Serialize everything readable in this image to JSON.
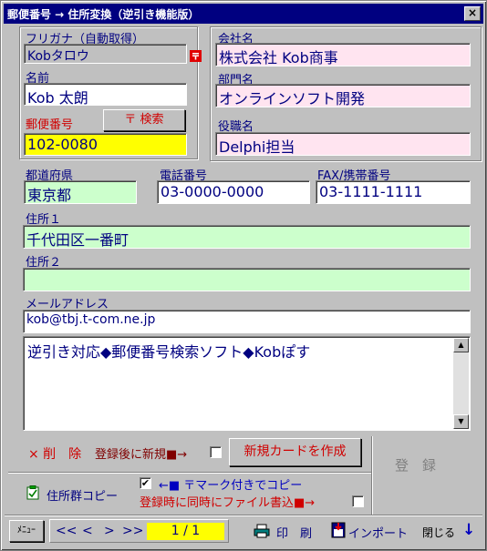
{
  "window": {
    "title": "郵便番号 → 住所変換（逆引き機能版）",
    "close_label": "×"
  },
  "furigana": {
    "label": "フリガナ（自動取得）",
    "value": "Kobタロウ"
  },
  "name": {
    "label": "名前",
    "value": "Kob 太朗"
  },
  "postal": {
    "label": "郵便番号",
    "value": "102-0080",
    "search_button": "〒 検索"
  },
  "company": {
    "label": "会社名",
    "value": "株式会社 Kob商事"
  },
  "department": {
    "label": "部門名",
    "value": "オンラインソフト開発"
  },
  "position": {
    "label": "役職名",
    "value": "Delphi担当"
  },
  "prefecture": {
    "label": "都道府県",
    "value": "東京都"
  },
  "phone": {
    "label": "電話番号",
    "value": "03-0000-0000"
  },
  "fax": {
    "label": "FAX/携帯番号",
    "value": "03-1111-1111"
  },
  "address1": {
    "label": "住所１",
    "value": "千代田区一番町"
  },
  "address2": {
    "label": "住所２",
    "value": ""
  },
  "email": {
    "label": "メールアドレス",
    "value": "kob@tbj.t-com.ne.jp"
  },
  "memo": {
    "value": "逆引き対応◆郵便番号検索ソフト◆Kobぽす"
  },
  "actions": {
    "delete_label": "× 削　除",
    "new_after_register_label": "登録後に新規■→",
    "new_card_button": "新規カードを作成",
    "register_button": "登　録",
    "copy_address_label": "住所群コピー",
    "copy_with_mark_label": "←■ 〒マーク付きでコピー",
    "write_file_label": "登録時に同時にファイル書込■→",
    "copy_with_mark_checked": true,
    "new_after_register_checked": false,
    "write_file_checked": false
  },
  "bottom": {
    "menu_button": "ﾒﾆｭｰ",
    "nav_first": "<<",
    "nav_prev": "<",
    "nav_next": ">",
    "nav_last": ">>",
    "record_position": "1 / 1",
    "print_label": "印　刷",
    "import_label": "インポート",
    "close_label": "閉じる",
    "down_arrow": "↓"
  },
  "colors": {
    "title_bar": "#000080",
    "label_navy": "#000080",
    "label_red": "#d00000",
    "pink_field": "#ffe4f0",
    "green_field": "#ccffcc",
    "yellow_field": "#ffff00",
    "window_bg": "#c0c0c0"
  }
}
